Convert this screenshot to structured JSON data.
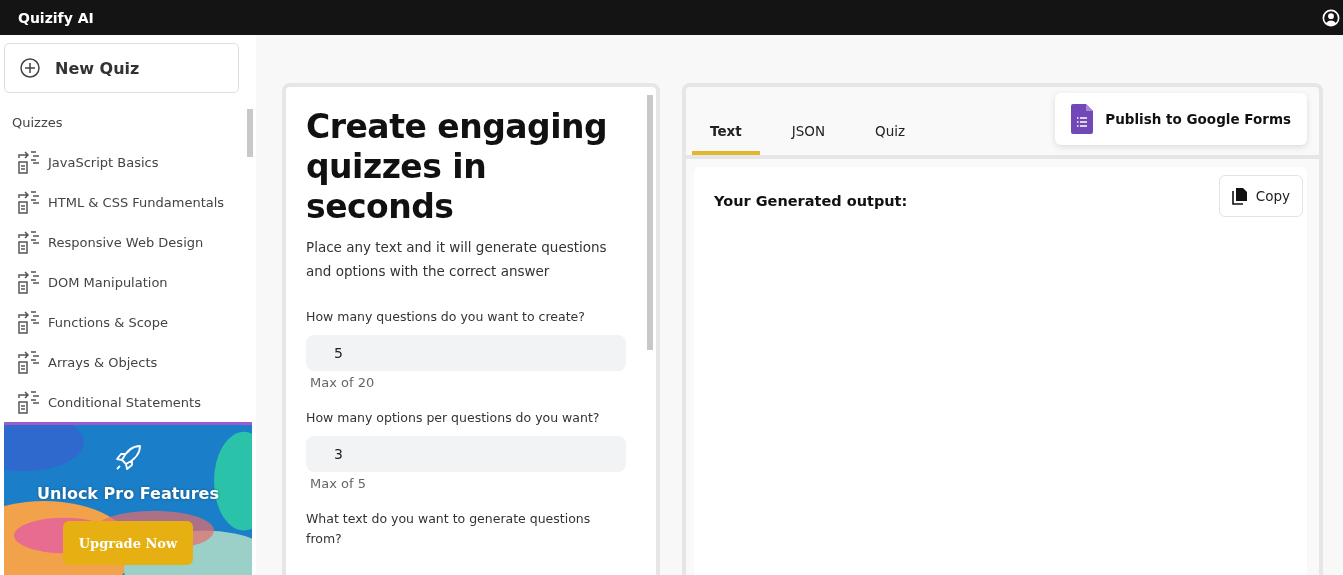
{
  "app": {
    "title": "Quizify AI"
  },
  "sidebar": {
    "new_button": "New Quiz",
    "section_label": "Quizzes",
    "items": [
      {
        "label": "JavaScript Basics"
      },
      {
        "label": "HTML & CSS Fundamentals"
      },
      {
        "label": "Responsive Web Design"
      },
      {
        "label": "DOM Manipulation"
      },
      {
        "label": "Functions & Scope"
      },
      {
        "label": "Arrays & Objects"
      },
      {
        "label": "Conditional Statements"
      }
    ],
    "promo": {
      "title": "Unlock Pro Features",
      "button": "Upgrade Now"
    }
  },
  "form": {
    "heading": "Create engaging quizzes in seconds",
    "description": "Place any text and it will generate questions and options with the correct answer",
    "fields": [
      {
        "label": "How many questions do you want to create?",
        "value": "5",
        "hint": "Max of 20"
      },
      {
        "label": "How many options per questions do you want?",
        "value": "3",
        "hint": "Max of 5"
      }
    ],
    "text_label": "What text do you want to generate questions from?"
  },
  "output": {
    "tabs": [
      {
        "label": "Text",
        "selected": true
      },
      {
        "label": "JSON",
        "selected": false
      },
      {
        "label": "Quiz",
        "selected": false
      }
    ],
    "publish_button": "Publish to Google Forms",
    "heading": "Your Generated output:",
    "copy_button": "Copy"
  }
}
